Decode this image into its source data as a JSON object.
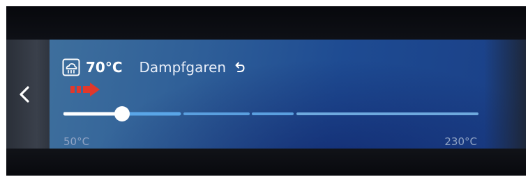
{
  "header": {
    "mode_icon": "steam-cloud-icon",
    "temperature": "70°C",
    "program": "Dampfgaren",
    "reset_icon": "undo-arrow-icon"
  },
  "navigation": {
    "back_icon": "chevron-left-icon"
  },
  "slider": {
    "min_label": "50°C",
    "max_label": "230°C",
    "value_fraction": 0.111,
    "accent_color": "#5aa6e8",
    "knob_color": "#ffffff"
  },
  "annotation": {
    "arrow_icon": "red-dashed-arrow-icon",
    "color": "#e0382b"
  }
}
